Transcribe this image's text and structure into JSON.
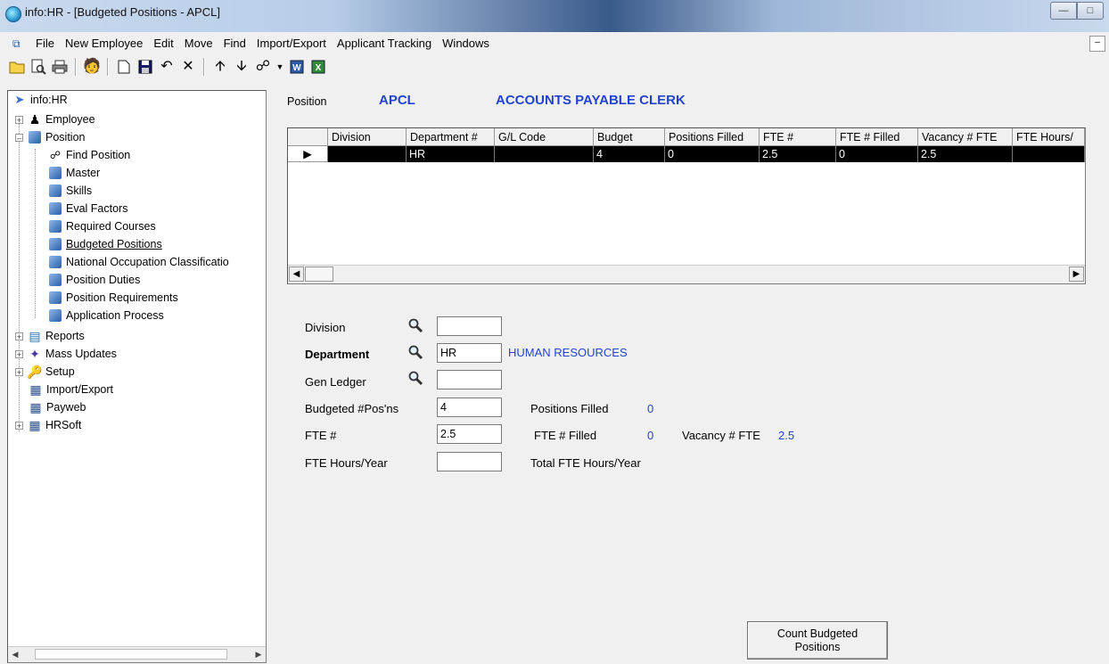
{
  "window": {
    "title": "info:HR - [Budgeted Positions - APCL]"
  },
  "menu": [
    "File",
    "New Employee",
    "Edit",
    "Move",
    "Find",
    "Import/Export",
    "Applicant Tracking",
    "Windows"
  ],
  "tree": {
    "root": "info:HR",
    "items": [
      {
        "label": "Employee"
      },
      {
        "label": "Position"
      },
      {
        "label": "Find Position"
      },
      {
        "label": "Master"
      },
      {
        "label": "Skills"
      },
      {
        "label": "Eval Factors"
      },
      {
        "label": "Required Courses"
      },
      {
        "label": "Budgeted Positions"
      },
      {
        "label": "National Occupation Classificatio"
      },
      {
        "label": "Position Duties"
      },
      {
        "label": "Position Requirements"
      },
      {
        "label": "Application Process"
      },
      {
        "label": "Reports"
      },
      {
        "label": "Mass Updates"
      },
      {
        "label": "Setup"
      },
      {
        "label": "Import/Export"
      },
      {
        "label": "Payweb"
      },
      {
        "label": "HRSoft"
      }
    ]
  },
  "position": {
    "label": "Position",
    "code": "APCL",
    "description": "ACCOUNTS PAYABLE CLERK"
  },
  "grid": {
    "columns": [
      "Division",
      "Department #",
      "G/L Code",
      "Budget",
      "Positions Filled",
      "FTE #",
      "FTE # Filled",
      "Vacancy # FTE",
      "FTE Hours/"
    ],
    "rows": [
      [
        "",
        "HR",
        "",
        "4",
        "0",
        "2.5",
        "0",
        "2.5",
        ""
      ]
    ]
  },
  "form": {
    "division": {
      "label": "Division",
      "value": ""
    },
    "department": {
      "label": "Department",
      "value": "HR",
      "description": "HUMAN RESOURCES"
    },
    "gen_ledger": {
      "label": "Gen Ledger",
      "value": ""
    },
    "budgeted": {
      "label": "Budgeted #Pos'ns",
      "value": "4"
    },
    "positions_filled": {
      "label": "Positions Filled",
      "value": "0"
    },
    "fte": {
      "label": "FTE #",
      "value": "2.5"
    },
    "fte_filled": {
      "label": "FTE # Filled",
      "value": "0"
    },
    "vacancy_fte": {
      "label": "Vacancy # FTE",
      "value": "2.5"
    },
    "fte_hours": {
      "label": "FTE Hours/Year",
      "value": ""
    },
    "total_fte_hours": {
      "label": "Total FTE Hours/Year"
    }
  },
  "buttons": {
    "count_line1": "Count Budgeted",
    "count_line2": "Positions"
  }
}
